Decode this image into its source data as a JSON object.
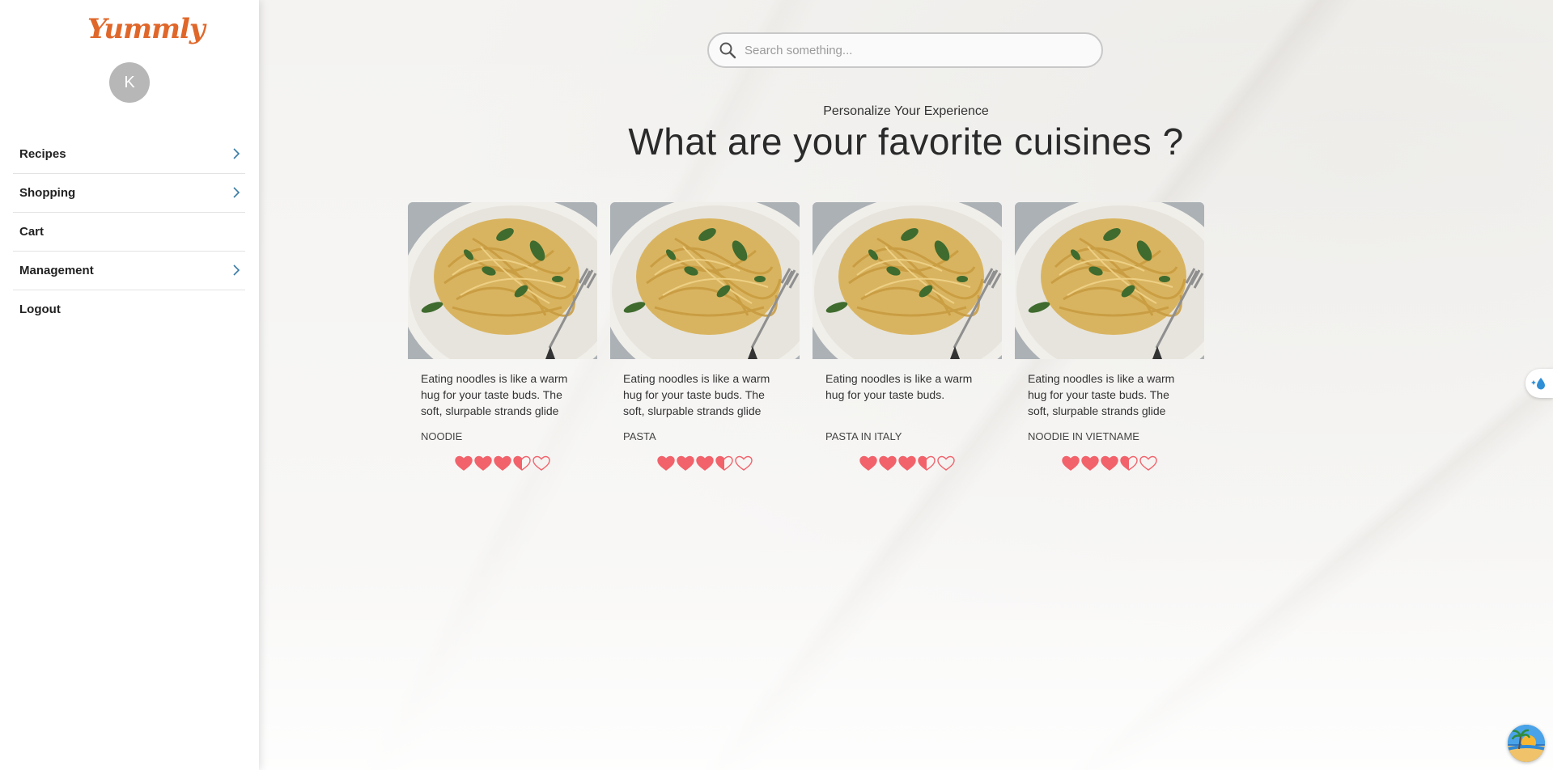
{
  "brand": {
    "logo_text": "Yummly",
    "accent_color": "#e0672a"
  },
  "user": {
    "avatar_initial": "K"
  },
  "sidebar": {
    "items": [
      {
        "label": "Recipes",
        "has_submenu": true
      },
      {
        "label": "Shopping",
        "has_submenu": true
      },
      {
        "label": "Cart",
        "has_submenu": false
      },
      {
        "label": "Management",
        "has_submenu": true
      },
      {
        "label": "Logout",
        "has_submenu": false
      }
    ],
    "chevron_color": "#3a7ca5"
  },
  "search": {
    "placeholder": "Search something...",
    "value": ""
  },
  "main": {
    "subheading": "Personalize Your Experience",
    "heading": "What are your favorite cuisines ?"
  },
  "cards": [
    {
      "description": "Eating noodles is like a warm hug for your taste buds. The soft, slurpable strands glide",
      "name": "NOODIE",
      "rating": 3.5
    },
    {
      "description": "Eating noodles is like a warm hug for your taste buds. The soft, slurpable strands glide",
      "name": "PASTA",
      "rating": 3.5
    },
    {
      "description": "Eating noodles is like a warm hug for your taste buds.",
      "name": "PASTA IN ITALY",
      "rating": 3.5
    },
    {
      "description": "Eating noodles is like a warm hug for your taste buds. The soft, slurpable strands glide",
      "name": "NOODIE IN VIETNAME",
      "rating": 3.5
    }
  ],
  "rating_max": 5,
  "heart_color": "#f2626b"
}
